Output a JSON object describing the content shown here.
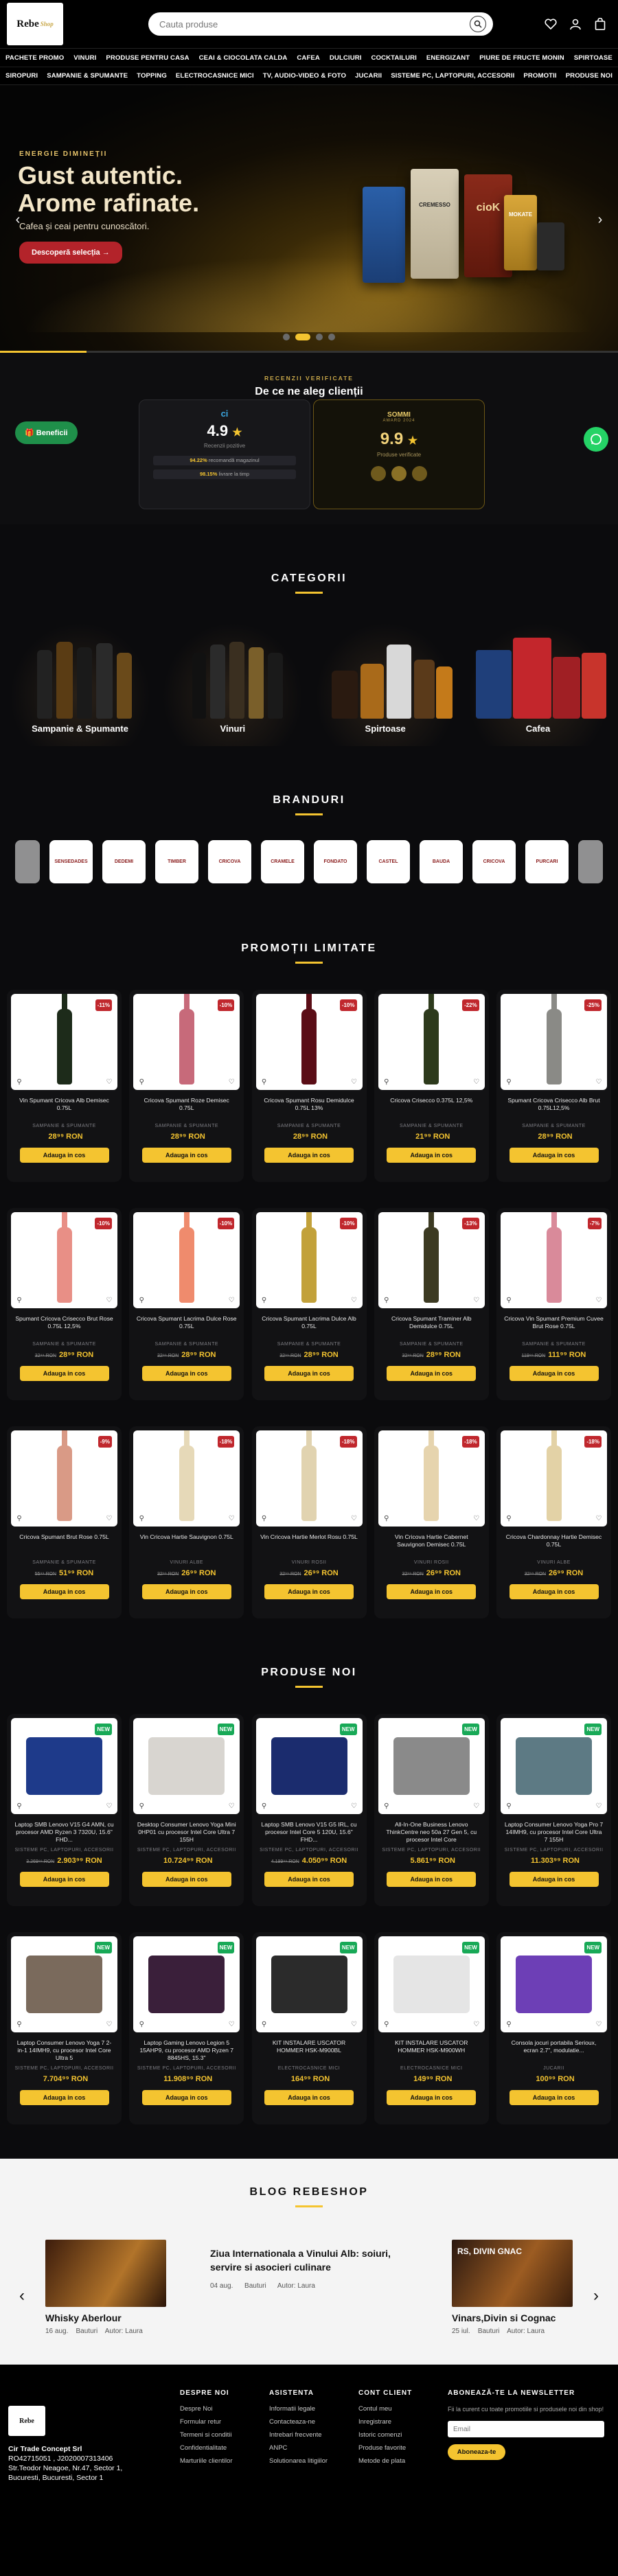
{
  "header": {
    "logo": "Rebe",
    "logo_suffix": "Shop",
    "search_placeholder": "Cauta produse",
    "icons": [
      "heart-icon",
      "user-icon",
      "bag-icon"
    ]
  },
  "nav": {
    "row1": [
      "PACHETE PROMO",
      "VINURI",
      "PRODUSE PENTRU CASA",
      "CEAI & CIOCOLATA CALDA",
      "CAFEA",
      "DULCIURI",
      "COCKTAILURI",
      "ENERGIZANT",
      "PIURE DE FRUCTE MONIN",
      "SPIRTOASE"
    ],
    "row2": [
      "SIROPURI",
      "SAMPANIE & SPUMANTE",
      "TOPPING",
      "ELECTROCASNICE MICI",
      "TV, AUDIO-VIDEO & FOTO",
      "JUCARII",
      "SISTEME PC, LAPTOPURI, ACCESORII",
      "PROMOTII",
      "PRODUSE NOI"
    ]
  },
  "hero": {
    "eyebrow": "ENERGIE DIMINEȚII",
    "title_line1": "Gust autentic.",
    "title_line2": "Arome rafinate.",
    "subtitle": "Cafea și ceai pentru cunoscători.",
    "cta": "Descoperă selecția →",
    "slides": 4,
    "active_slide": 2,
    "bag_labels": [
      "CREMESSO",
      "cioK",
      "MOKATE"
    ]
  },
  "reviews": {
    "eyebrow": "RECENZII VERIFICATE",
    "title": "De ce ne aleg clienții",
    "card1": {
      "score": "4.9",
      "star": "★",
      "label": "Recenzii pozitive",
      "line1_pct": "94.22%",
      "line1_txt": "recomandă magazinul",
      "line2_pct": "98.15%",
      "line2_txt": "livrare la timp"
    },
    "card2": {
      "brand": "SOMMI",
      "sub": "AWARD 2024",
      "score": "9.9",
      "star": "★",
      "label": "Produse verificate"
    },
    "beneficii": "Beneficii"
  },
  "categories": {
    "title": "CATEGORII",
    "items": [
      "Sampanie & Spumante",
      "Vinuri",
      "Spirtoase",
      "Cafea"
    ]
  },
  "brands": {
    "title": "BRANDURI",
    "items": [
      "",
      "SENSEDADES",
      "DEDEMI",
      "TIMBER",
      "CRICOVA",
      "CRAMELE",
      "FONDATO",
      "CASTEL",
      "BAUDA",
      "CRICOVA",
      "PURCARI",
      ""
    ]
  },
  "promo": {
    "title": "PROMOȚII LIMITATE",
    "products": [
      {
        "name": "Vin Spumant Cricova Alb Demisec 0.75L",
        "cat": "SAMPANIE & SPUMANTE",
        "old": "",
        "price": "28⁹⁹ RON",
        "badge": "-11%",
        "color": "#1d2b1a"
      },
      {
        "name": "Cricova Spumant Roze Demisec 0.75L",
        "cat": "SAMPANIE & SPUMANTE",
        "old": "",
        "price": "28⁹⁹ RON",
        "badge": "-10%",
        "color": "#c76a7a"
      },
      {
        "name": "Cricova Spumant Rosu Demidulce 0.75L 13%",
        "cat": "SAMPANIE & SPUMANTE",
        "old": "",
        "price": "28⁹⁹ RON",
        "badge": "-10%",
        "color": "#5a0d16"
      },
      {
        "name": "Cricova Crisecco 0.375L 12,5%",
        "cat": "SAMPANIE & SPUMANTE",
        "old": "",
        "price": "21⁹⁹ RON",
        "badge": "-22%",
        "color": "#2d3a1c"
      },
      {
        "name": "Spumant Cricova Crisecco Alb Brut 0.75L12,5%",
        "cat": "SAMPANIE & SPUMANTE",
        "old": "",
        "price": "28⁹⁹ RON",
        "badge": "-25%",
        "color": "#8a8a86"
      },
      {
        "name": "Spumant Cricova Crisecco Brut Rose 0.75L 12,5%",
        "cat": "SAMPANIE & SPUMANTE",
        "old": "32⁹⁹ RON",
        "price": "28⁹⁹ RON",
        "badge": "-10%",
        "color": "#e88f86"
      },
      {
        "name": "Cricova Spumant Lacrima Dulce Rose 0.75L",
        "cat": "SAMPANIE & SPUMANTE",
        "old": "32⁹⁹ RON",
        "price": "28⁹⁹ RON",
        "badge": "-10%",
        "color": "#ef8b6d"
      },
      {
        "name": "Cricova Spumant Lacrima Dulce Alb 0.75L",
        "cat": "SAMPANIE & SPUMANTE",
        "old": "32⁹⁹ RON",
        "price": "28⁹⁹ RON",
        "badge": "-10%",
        "color": "#c2a13a"
      },
      {
        "name": "Cricova Spumant Traminer Alb Demidulce 0.75L",
        "cat": "SAMPANIE & SPUMANTE",
        "old": "32⁹⁹ RON",
        "price": "28⁹⁹ RON",
        "badge": "-13%",
        "color": "#3c3a22"
      },
      {
        "name": "Cricova Vin Spumant Premium Cuvee Brut Rose 0.75L",
        "cat": "SAMPANIE & SPUMANTE",
        "old": "119⁹⁹ RON",
        "price": "111⁹⁹ RON",
        "badge": "-7%",
        "color": "#d98a9a"
      },
      {
        "name": "Cricova Spumant Brut Rose 0.75L",
        "cat": "SAMPANIE & SPUMANTE",
        "old": "55⁹⁹ RON",
        "price": "51⁹⁹ RON",
        "badge": "-9%",
        "color": "#d99a86"
      },
      {
        "name": "Vin Cricova Hartie Sauvignon 0.75L",
        "cat": "VINURI ALBE",
        "old": "32⁹⁹ RON",
        "price": "26⁹⁹ RON",
        "badge": "-18%",
        "color": "#e6d9b8"
      },
      {
        "name": "Vin Cricova Hartie Merlot Rosu 0.75L",
        "cat": "VINURI ROSII",
        "old": "32⁹⁹ RON",
        "price": "26⁹⁹ RON",
        "badge": "-18%",
        "color": "#e1d3b0"
      },
      {
        "name": "Vin Cricova Hartie Cabernet Sauvignon Demisec 0.75L",
        "cat": "VINURI ROSII",
        "old": "32⁹⁹ RON",
        "price": "26⁹⁹ RON",
        "badge": "-18%",
        "color": "#e6d4ae"
      },
      {
        "name": "Cricova Chardonnay Hartie Demisec 0.75L",
        "cat": "VINURI ALBE",
        "old": "32⁹⁹ RON",
        "price": "26⁹⁹ RON",
        "badge": "-18%",
        "color": "#e3d2a6"
      }
    ],
    "add_label": "Adauga in cos"
  },
  "new_products": {
    "title": "PRODUSE NOI",
    "products": [
      {
        "name": "Laptop SMB Lenovo V15 G4 AMN, cu procesor AMD Ryzen 3 7320U, 15.6\" FHD...",
        "cat": "SISTEME PC, LAPTOPURI, ACCESORII",
        "old": "3.269⁹⁹ RON",
        "price": "2.903⁹⁹ RON",
        "badge": "NEW",
        "color": "#1e3a8a"
      },
      {
        "name": "Desktop Consumer Lenovo Yoga Mini 0HP01 cu procesor Intel Core Ultra 7 155H",
        "cat": "SISTEME PC, LAPTOPURI, ACCESORII",
        "old": "",
        "price": "10.724⁹⁹ RON",
        "badge": "NEW",
        "color": "#d8d5d0"
      },
      {
        "name": "Laptop SMB Lenovo V15 G5 IRL, cu procesor Intel Core 5 120U, 15.6\" FHD...",
        "cat": "SISTEME PC, LAPTOPURI, ACCESORII",
        "old": "4.199⁹⁹ RON",
        "price": "4.050⁹⁹ RON",
        "badge": "NEW",
        "color": "#1b2c6e"
      },
      {
        "name": "All-In-One Business Lenovo ThinkCentre neo 50a 27 Gen 5, cu procesor Intel Core",
        "cat": "SISTEME PC, LAPTOPURI, ACCESORII",
        "old": "",
        "price": "5.861⁹⁹ RON",
        "badge": "NEW",
        "color": "#8a8a8a"
      },
      {
        "name": "Laptop Consumer Lenovo Yoga Pro 7 14IMH9, cu procesor Intel Core Ultra 7 155H",
        "cat": "SISTEME PC, LAPTOPURI, ACCESORII",
        "old": "",
        "price": "11.303⁹⁹ RON",
        "badge": "NEW",
        "color": "#5d7a84"
      },
      {
        "name": "Laptop Consumer Lenovo Yoga 7 2-in-1 14IMH9, cu procesor Intel Core Ultra 5",
        "cat": "SISTEME PC, LAPTOPURI, ACCESORII",
        "old": "",
        "price": "7.704⁹⁹ RON",
        "badge": "NEW",
        "color": "#7a6a5c"
      },
      {
        "name": "Laptop Gaming Lenovo Legion 5 15AHP9, cu procesor AMD Ryzen 7 8845HS, 15.3\"",
        "cat": "SISTEME PC, LAPTOPURI, ACCESORII",
        "old": "",
        "price": "11.908⁹⁹ RON",
        "badge": "NEW",
        "color": "#3a1f3a"
      },
      {
        "name": "KIT INSTALARE USCATOR HOMMER HSK-M900BL",
        "cat": "ELECTROCASNICE MICI",
        "old": "",
        "price": "164⁹⁹ RON",
        "badge": "NEW",
        "color": "#2b2b2b"
      },
      {
        "name": "KIT INSTALARE USCATOR HOMMER HSK-M900WH",
        "cat": "ELECTROCASNICE MICI",
        "old": "",
        "price": "149⁹⁹ RON",
        "badge": "NEW",
        "color": "#e5e5e5"
      },
      {
        "name": "Consola jocuri portabila Serioux, ecran 2.7\", modulatie...",
        "cat": "JUCARII",
        "old": "",
        "price": "100⁹⁹ RON",
        "badge": "NEW",
        "color": "#6d3fb6"
      }
    ]
  },
  "blog": {
    "title": "BLOG REBESHOP",
    "featured_title": "Ziua Internationala a Vinului Alb: soiuri, servire si asocieri culinare",
    "featured_date": "04 aug.",
    "featured_cat": "Bauturi",
    "featured_author": "Autor: Laura",
    "left_title": "Whisky Aberlour",
    "left_date": "16 aug.",
    "left_cat": "Bauturi",
    "left_author": "Autor: Laura",
    "right_title": "Vinars,Divin si Cognac",
    "right_date": "25 iul.",
    "right_cat": "Bauturi",
    "right_author": "Autor: Laura",
    "right_img_text": "RS, DIVIN GNAC"
  },
  "footer": {
    "company": "Cir Trade Concept Srl",
    "cui": "RO42715051 , J2020007313406",
    "address1": "Str.Teodor Neagoe, Nr.47, Sector 1,",
    "address2": "Bucuresti, Bucuresti, Sector 1",
    "col1_title": "DESPRE NOI",
    "col1": [
      "Despre Noi",
      "Formular retur",
      "Termeni si conditii",
      "Confidentialitate",
      "Marturiile clientilor"
    ],
    "col2_title": "ASISTENTA",
    "col2": [
      "Informatii legale",
      "Contacteaza-ne",
      "Intrebari frecvente",
      "ANPC",
      "Solutionarea litigiilor"
    ],
    "col3_title": "CONT CLIENT",
    "col3": [
      "Contul meu",
      "Inregistrare",
      "Istoric comenzi",
      "Produse favorite",
      "Metode de plata"
    ],
    "col4_title": "ABONEAZĂ-TE LA NEWSLETTER",
    "newsletter_text": "Fii la curent cu toate promotiile si produsele noi din shop!",
    "email_placeholder": "Email",
    "subscribe": "Aboneaza-te"
  }
}
